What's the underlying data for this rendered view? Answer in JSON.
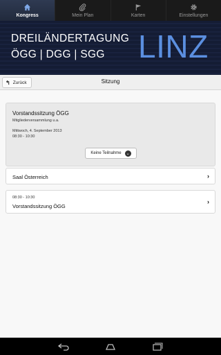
{
  "tabs": [
    {
      "label": "Kongress",
      "icon": "home-icon",
      "active": true
    },
    {
      "label": "Mein Plan",
      "icon": "paperclip-icon",
      "active": false
    },
    {
      "label": "Karten",
      "icon": "flag-icon",
      "active": false
    },
    {
      "label": "Einstellungen",
      "icon": "gear-icon",
      "active": false
    }
  ],
  "banner": {
    "line1": "DREILÄNDERTAGUNG",
    "line2": "ÖGG | DGG | SGG",
    "city": "LINZ"
  },
  "header": {
    "back_label": "Zurück",
    "title": "Sitzung"
  },
  "session": {
    "name": "Vorstandssitzung ÖGG",
    "subtitle": "Mitgliederversammlung u.a.",
    "date": "Mittwoch, 4. September 2013",
    "time": "08:30 - 10:30",
    "attendance_select": "Keine Teilnahme"
  },
  "room": {
    "label": "Saal Österreich"
  },
  "item": {
    "time": "08:30 - 10:30",
    "label": "Vorstandssitzung ÖGG"
  },
  "colors": {
    "accent": "#5b8fe0",
    "tab_active": "#2a344a",
    "banner_bg": "#141c34"
  }
}
